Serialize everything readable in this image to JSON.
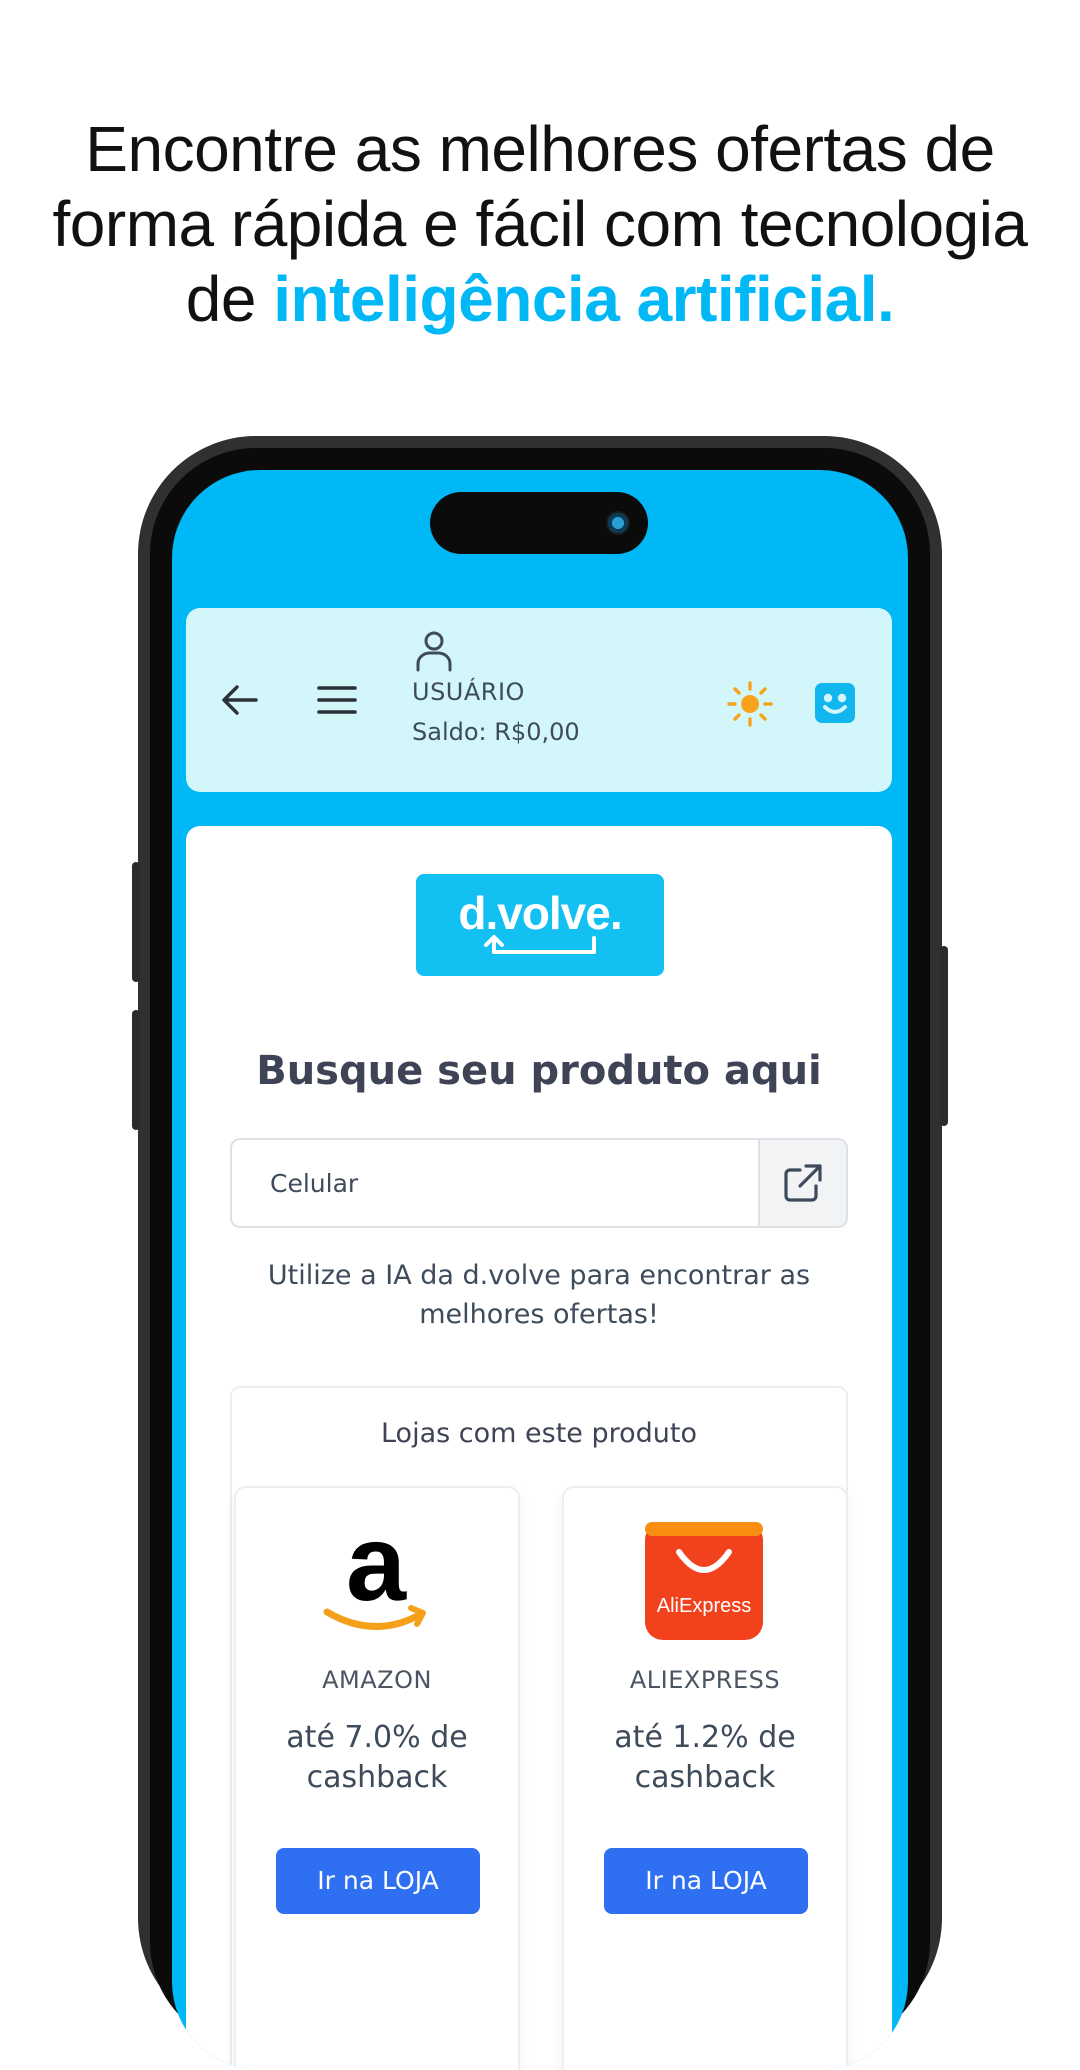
{
  "headline": {
    "line1": "Encontre as melhores ofertas de",
    "line2": "forma rápida e fácil com tecnologia",
    "line3_prefix": "de ",
    "line3_highlight": "inteligência artificial."
  },
  "header": {
    "user_label": "USUÁRIO",
    "balance": "Saldo: R$0,00",
    "icons": [
      "arrow-left-icon",
      "hamburger-menu-icon",
      "user-icon",
      "sun-icon",
      "robot-face-icon"
    ]
  },
  "main": {
    "logo_text": "d.volve.",
    "title": "Busque seu produto aqui",
    "search": {
      "value": "Celular",
      "button_icon": "external-link-icon"
    },
    "hint": "Utilize a IA da d.volve para encontrar as melhores ofertas!",
    "stores_title": "Lojas com este produto",
    "stores": [
      {
        "name": "AMAZON",
        "cashback": "até 7.0% de cashback",
        "button": "Ir na LOJA",
        "logo": "amazon-logo"
      },
      {
        "name": "ALIEXPRESS",
        "cashback": "até 1.2% de cashback",
        "button": "Ir na LOJA",
        "logo": "aliexpress-logo",
        "logo_text": "AliExpress"
      }
    ]
  },
  "colors": {
    "brand_blue": "#00b8f5",
    "header_bg": "#d3f6fb",
    "button_blue": "#2f6ff2",
    "sun_orange": "#f7a31c",
    "aliexpress_red": "#f2421d"
  }
}
